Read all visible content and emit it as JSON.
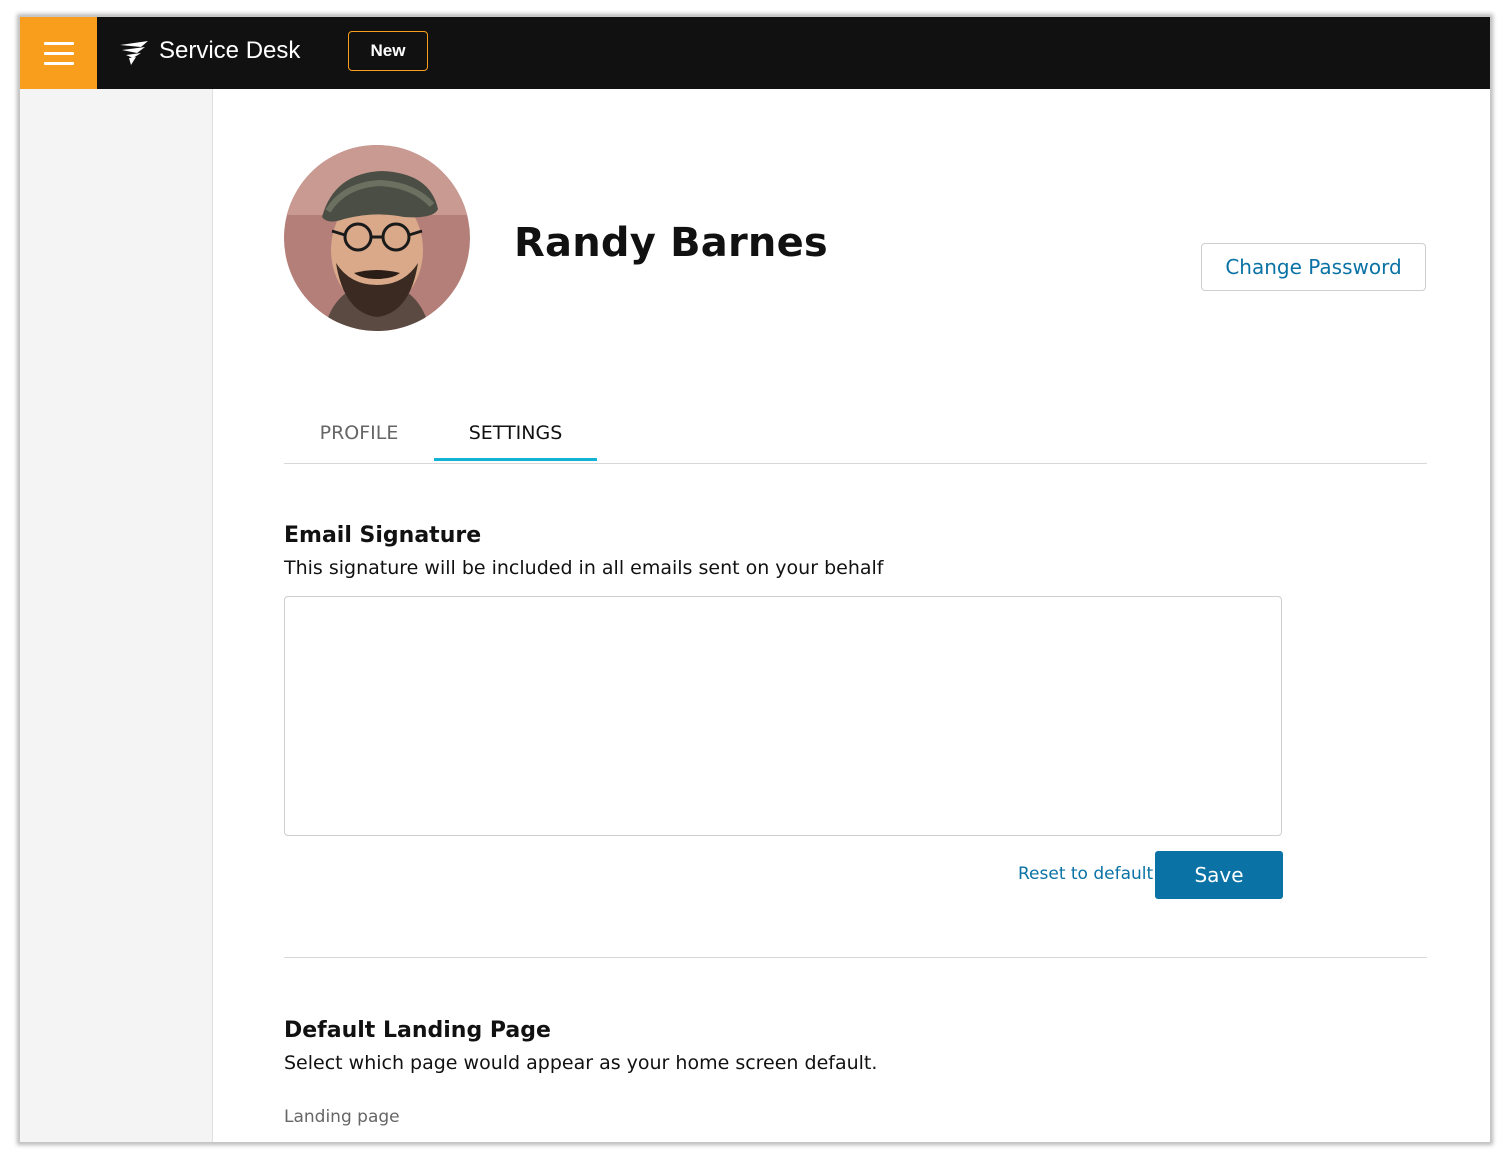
{
  "topbar": {
    "menu_icon": "hamburger-menu-icon",
    "brand_icon": "solarwinds-bird-icon",
    "app_title": "Service Desk",
    "new_button": "New",
    "accent_color": "#f99d1c"
  },
  "profile": {
    "name": "Randy Barnes",
    "avatar_icon": "user-avatar-photo",
    "change_password": "Change Password"
  },
  "tabs": [
    {
      "label": "PROFILE",
      "active": false
    },
    {
      "label": "SETTINGS",
      "active": true
    }
  ],
  "email_signature": {
    "title": "Email Signature",
    "description": "This signature will be included in all emails sent on your behalf",
    "value": "",
    "reset_label": "Reset to default",
    "save_label": "Save"
  },
  "landing_page": {
    "title": "Default Landing Page",
    "description": "Select which page would appear as your home screen default.",
    "field_label": "Landing page"
  },
  "colors": {
    "link": "#0a72a5",
    "tab_indicator": "#12b3d4",
    "topbar": "#111111"
  }
}
